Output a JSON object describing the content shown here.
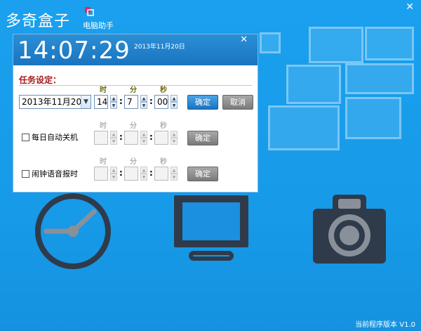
{
  "app": {
    "logo_main": "多奇盒子",
    "logo_sub": "电脑助手",
    "close_glyph": "✕"
  },
  "clock": {
    "time": "14:07:29",
    "date": "2013年11月20日",
    "close_glyph": "✕"
  },
  "task": {
    "section_title": "任务设定：",
    "date_value": "2013年11月20",
    "labels": {
      "hour": "时",
      "minute": "分",
      "second": "秒"
    },
    "hour": "14",
    "minute": "7",
    "second": "00",
    "confirm_label": "确定",
    "cancel_label": "取消"
  },
  "shutdown": {
    "label": "每日自动关机",
    "checked": false,
    "confirm_label": "确定"
  },
  "alarm": {
    "label": "闹钟语音报时",
    "checked": false,
    "confirm_label": "确定"
  },
  "footer": {
    "version_label": "当前程序版本",
    "version": "V1.0"
  },
  "icons": [
    "clock-icon",
    "computer-icon",
    "camera-icon"
  ],
  "colors": {
    "background": "#179be9",
    "accent": "#1b73c0",
    "section_title": "#a81a1a"
  }
}
